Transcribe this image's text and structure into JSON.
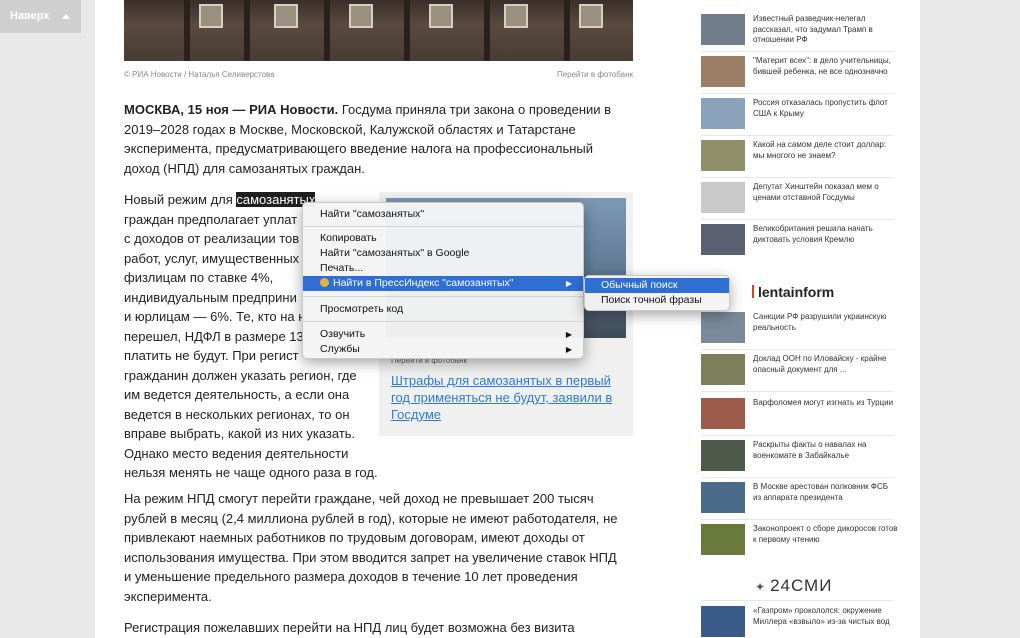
{
  "top_button": {
    "label": "Наверх"
  },
  "photo": {
    "credit": "© РИА Новости / Наталья Селиверстова",
    "bank_link": "Перейти в фотобанк"
  },
  "article": {
    "lead_bold": "МОСКВА, 15 ноя — РИА Новости.",
    "lead_rest": " Госдума приняла три закона о проведении в 2019–2028 годах в Москве, Московской, Калужской областях и Татарстане эксперимента, предусматривающего введение налога на профессиональный доход (НПД) для самозанятых граждан.",
    "p2": {
      "before": "Новый режим для ",
      "selected": "самозанятых",
      "lines": [
        "граждан предполагает уплат",
        "с доходов от реализации тов",
        "работ, услуг, имущественных",
        "физлицам по ставке 4%,",
        "индивидуальным предприни",
        "и юрлицам — 6%. Те, кто на н",
        "перешел, НДФЛ в размере 13",
        "платить не будут. При регист",
        "гражданин должен указать регион, где",
        "им ведется деятельность, а если она",
        "ведется в нескольких регионах, то он",
        "вправе выбрать, какой из них указать.",
        "Однако место ведения деятельности",
        "нельзя менять не чаще одного раза в год."
      ]
    },
    "p3": "На режим НПД смогут перейти граждане, чей доход не превышает 200 тысяч рублей в месяц (2,4 миллиона рублей в год), которые не имеют работодателя, не привлекают наемных работников по трудовым договорам, имеют доходы от использования имущества. При этом вводится запрет на увеличение ставок НПД и уменьшение предельного размера доходов в течение 10 лет проведения эксперимента.",
    "p4": "Регистрация пожелавших перейти на НПД лиц будет возможна без визита"
  },
  "related": {
    "photo_link": "Перейти в фотобанк",
    "link": "Штрафы для самозанятых в первый год применяться не будут, заявили в Госдуме"
  },
  "sidebar": {
    "news": [
      {
        "text": "Известный разведчик-нелегал рассказал, что задумал Трамп в отношении РФ",
        "color": "#6f7d8c"
      },
      {
        "text": "\"Материт всех\": в дело учительницы, бившей ребенка, не все однозначно",
        "color": "#9a7e66"
      },
      {
        "text": "Россия отказалась пропустить флот США к Крыму",
        "color": "#8aa3bb"
      },
      {
        "text": "Какой на самом деле стоит доллар: мы многого не знаем?",
        "color": "#8f8f6a"
      },
      {
        "text": "Депутат Хинштейн показал мем о ценами отставной Госдумы",
        "color": "#c9c9c9"
      },
      {
        "text": "Великобритания решила начать диктовать условия Кремлю",
        "color": "#5b6170"
      }
    ],
    "lentainform_label": "lentainform",
    "news2": [
      {
        "text": "Санкции РФ разрушили украинскую реальность",
        "color": "#7a8a9a"
      },
      {
        "text": "Доклад ООН по Иловайску - крайне опасный документ для ...",
        "color": "#7c7f5a"
      },
      {
        "text": "Варфоломея могут изгнать из Турции",
        "color": "#9b5a4a"
      },
      {
        "text": "Раскрыты факты о навалах на военкомате в Забайкалье",
        "color": "#4f5a4a"
      },
      {
        "text": "В Москве арестован полковник ФСБ из аппарата президента",
        "color": "#4a6a8a"
      },
      {
        "text": "Законопроект о сборе дикоросов готов к первому чтению",
        "color": "#6a7a3a"
      }
    ],
    "smi24_label": "24СМИ",
    "smi_news": {
      "text": "«Газпром» прокололся: окружение Миллера «взвыло» из-за чистых вод",
      "color": "#3a5a8a"
    }
  },
  "context_menu": {
    "items": [
      {
        "label": "Найти \"самозанятых\""
      },
      {
        "label": "Копировать"
      },
      {
        "label": "Найти \"самозанятых\" в Google"
      },
      {
        "label": "Печать..."
      },
      {
        "label": "Найти в ПрессИндекс \"самозанятых\""
      },
      {
        "label": "Просмотреть код"
      },
      {
        "label": "Озвучить"
      },
      {
        "label": "Службы"
      }
    ],
    "submenu_arrow": "▶",
    "submenu": [
      {
        "label": "Обычный поиск"
      },
      {
        "label": "Поиск точной фразы"
      }
    ]
  }
}
